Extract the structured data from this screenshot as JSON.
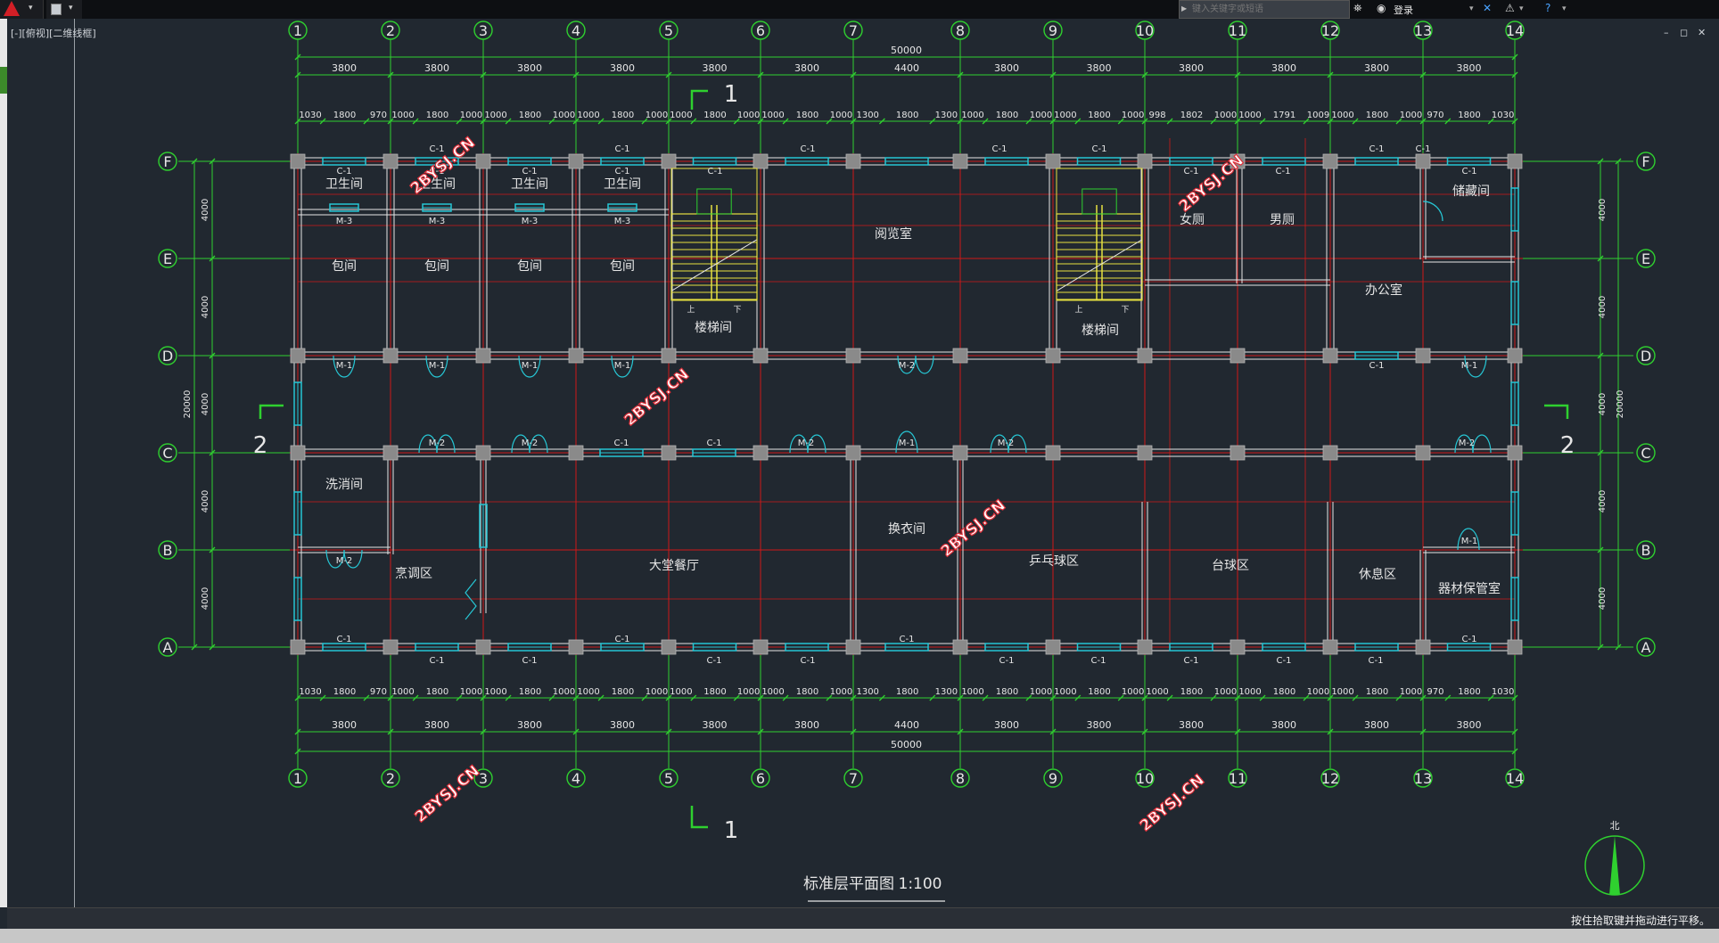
{
  "app": {
    "search_placeholder": "键入关键字或短语",
    "login_label": "登录",
    "view_label": "[-][俯视][二维线框]",
    "status_message": "按住拾取键并拖动进行平移。",
    "window_controls": [
      "–",
      "◻",
      "✕"
    ]
  },
  "drawing": {
    "title": "标准层平面图",
    "scale": "1:100",
    "watermark": "2BYSJ.CN",
    "north_label": "北",
    "column_axes": [
      "1",
      "2",
      "3",
      "4",
      "5",
      "6",
      "7",
      "8",
      "9",
      "10",
      "11",
      "12",
      "13",
      "14"
    ],
    "row_axes": [
      "F",
      "E",
      "D",
      "C",
      "B",
      "A"
    ],
    "bay_dims": [
      "3800",
      "3800",
      "3800",
      "3800",
      "3800",
      "3800",
      "4400",
      "3800",
      "3800",
      "3800",
      "3800",
      "3800",
      "3800"
    ],
    "total_dim": "50000",
    "detail_dims_top": [
      "1030",
      "1800",
      "970",
      "1000",
      "1800",
      "1000",
      "1000",
      "1800",
      "1000",
      "1000",
      "1800",
      "1000",
      "1000",
      "1800",
      "1000",
      "1000",
      "1800",
      "1000",
      "1300",
      "1800",
      "1300",
      "1000",
      "1800",
      "1000",
      "1000",
      "1800",
      "1000",
      "998",
      "1802",
      "1000",
      "1000",
      "1791",
      "1009",
      "1000",
      "1800",
      "1000",
      "970",
      "1800",
      "1030"
    ],
    "detail_dims_bottom": [
      "1030",
      "1800",
      "970",
      "1000",
      "1800",
      "1000",
      "1000",
      "1800",
      "1000",
      "1000",
      "1800",
      "1000",
      "1000",
      "1800",
      "1000",
      "1000",
      "1800",
      "1000",
      "1300",
      "1800",
      "1300",
      "1000",
      "1800",
      "1000",
      "1000",
      "1800",
      "1000",
      "1000",
      "1800",
      "1000",
      "1000",
      "1800",
      "1000",
      "1000",
      "1800",
      "1000",
      "970",
      "1800",
      "1030"
    ],
    "row_dims": [
      "4000",
      "4000",
      "4000",
      "4000",
      "4000"
    ],
    "row_total": "20000",
    "section_marks": [
      "1",
      "2"
    ],
    "rooms": [
      "卫生间",
      "卫生间",
      "卫生间",
      "卫生间",
      "包间",
      "包间",
      "包间",
      "包间",
      "楼梯间",
      "阅览室",
      "楼梯间",
      "女厕",
      "男厕",
      "储藏间",
      "办公室",
      "洗消间",
      "烹调区",
      "大堂餐厅",
      "换衣间",
      "乒乓球区",
      "台球区",
      "休息区",
      "器材保管室"
    ],
    "openings": [
      "C-1",
      "M-1",
      "M-2",
      "M-3"
    ],
    "stair_labels": [
      "上",
      "下"
    ]
  }
}
